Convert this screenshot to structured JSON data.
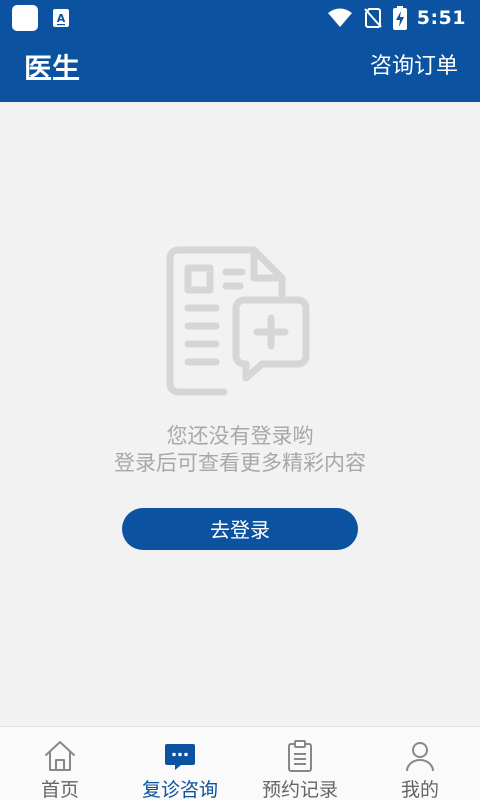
{
  "status_bar": {
    "time": "5:51",
    "icons": [
      "app-square-icon",
      "text-a-icon",
      "wifi-icon",
      "no-sim-icon",
      "battery-charging-icon"
    ]
  },
  "header": {
    "title": "医生",
    "orders_label": "咨询订单"
  },
  "empty_state": {
    "icon": "document-medical-chat-icon",
    "line1": "您还没有登录哟",
    "line2": "登录后可查看更多精彩内容",
    "button_label": "去登录"
  },
  "bottom_nav": {
    "items": [
      {
        "label": "首页",
        "icon": "home-icon"
      },
      {
        "label": "复诊咨询",
        "icon": "chat-bubble-icon",
        "active": true
      },
      {
        "label": "预约记录",
        "icon": "clipboard-icon"
      },
      {
        "label": "我的",
        "icon": "user-icon"
      }
    ]
  },
  "colors": {
    "primary": "#0b53a0",
    "background": "#f2f2f2",
    "muted_text": "#a8a8a8",
    "nav_inactive": "#666666"
  }
}
